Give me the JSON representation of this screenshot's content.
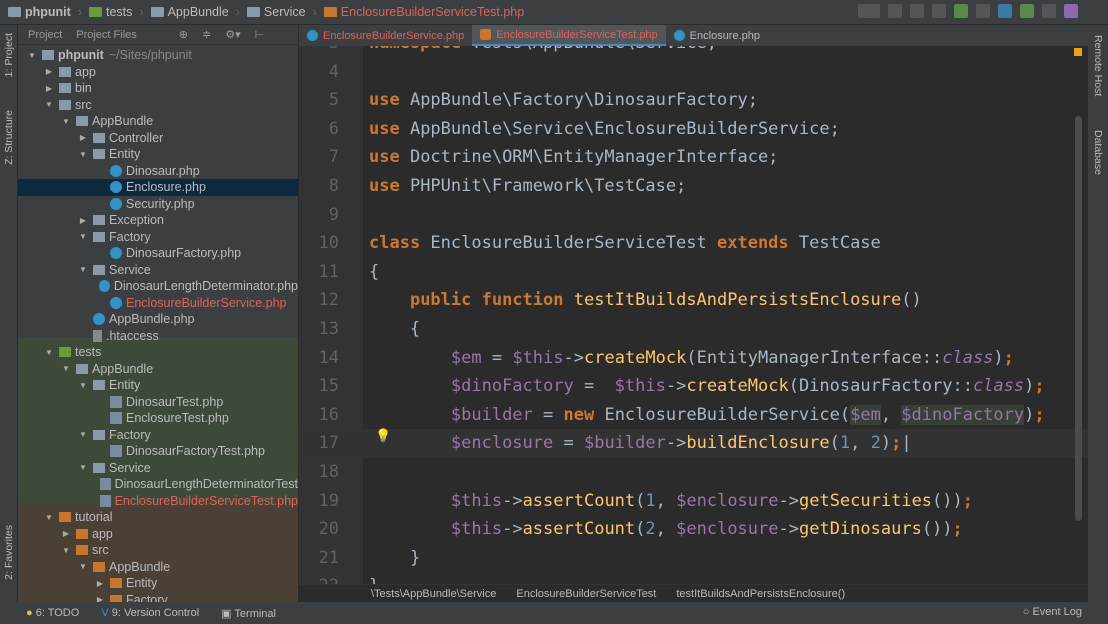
{
  "nav": {
    "crumbs": [
      "phpunit",
      "tests",
      "AppBundle",
      "Service"
    ],
    "file": "EnclosureBuilderServiceTest.php"
  },
  "left_tabs": {
    "project": "1: Project",
    "structure": "Z: Structure",
    "favorites": "2: Favorites"
  },
  "right_tabs": {
    "remote": "Remote Host",
    "database": "Database"
  },
  "sidebar": {
    "tabs": [
      "Project",
      "Project Files"
    ],
    "tree": [
      {
        "label": "phpunit",
        "suffix": "~/Sites/phpunit",
        "depth": 0,
        "type": "folder",
        "open": true,
        "bold": true
      },
      {
        "label": "app",
        "depth": 1,
        "type": "folder",
        "open": false
      },
      {
        "label": "bin",
        "depth": 1,
        "type": "folder",
        "open": false
      },
      {
        "label": "src",
        "depth": 1,
        "type": "folder",
        "open": true
      },
      {
        "label": "AppBundle",
        "depth": 2,
        "type": "folder",
        "open": true
      },
      {
        "label": "Controller",
        "depth": 3,
        "type": "folder",
        "open": false
      },
      {
        "label": "Entity",
        "depth": 3,
        "type": "folder",
        "open": true
      },
      {
        "label": "Dinosaur.php",
        "depth": 4,
        "type": "class"
      },
      {
        "label": "Enclosure.php",
        "depth": 4,
        "type": "class",
        "selected": true
      },
      {
        "label": "Security.php",
        "depth": 4,
        "type": "class"
      },
      {
        "label": "Exception",
        "depth": 3,
        "type": "folder",
        "open": false
      },
      {
        "label": "Factory",
        "depth": 3,
        "type": "folder",
        "open": true
      },
      {
        "label": "DinosaurFactory.php",
        "depth": 4,
        "type": "class"
      },
      {
        "label": "Service",
        "depth": 3,
        "type": "folder",
        "open": true
      },
      {
        "label": "DinosaurLengthDeterminator.php",
        "depth": 4,
        "type": "class"
      },
      {
        "label": "EnclosureBuilderService.php",
        "depth": 4,
        "type": "class",
        "modified": true
      },
      {
        "label": "AppBundle.php",
        "depth": 3,
        "type": "class"
      },
      {
        "label": ".htaccess",
        "depth": 3,
        "type": "file"
      },
      {
        "label": "tests",
        "depth": 1,
        "type": "folder",
        "open": true,
        "color": "green"
      },
      {
        "label": "AppBundle",
        "depth": 2,
        "type": "folder",
        "open": true
      },
      {
        "label": "Entity",
        "depth": 3,
        "type": "folder",
        "open": true
      },
      {
        "label": "DinosaurTest.php",
        "depth": 4,
        "type": "test"
      },
      {
        "label": "EnclosureTest.php",
        "depth": 4,
        "type": "test"
      },
      {
        "label": "Factory",
        "depth": 3,
        "type": "folder",
        "open": true
      },
      {
        "label": "DinosaurFactoryTest.php",
        "depth": 4,
        "type": "test"
      },
      {
        "label": "Service",
        "depth": 3,
        "type": "folder",
        "open": true
      },
      {
        "label": "DinosaurLengthDeterminatorTest",
        "depth": 4,
        "type": "test"
      },
      {
        "label": "EnclosureBuilderServiceTest.php",
        "depth": 4,
        "type": "test",
        "modified": true
      },
      {
        "label": "tutorial",
        "depth": 1,
        "type": "folder",
        "open": true,
        "color": "orange"
      },
      {
        "label": "app",
        "depth": 2,
        "type": "folder",
        "open": false,
        "color": "orange"
      },
      {
        "label": "src",
        "depth": 2,
        "type": "folder",
        "open": true,
        "color": "orange"
      },
      {
        "label": "AppBundle",
        "depth": 3,
        "type": "folder",
        "open": true,
        "color": "orange"
      },
      {
        "label": "Entity",
        "depth": 4,
        "type": "folder",
        "open": false,
        "color": "orange"
      },
      {
        "label": "Factory",
        "depth": 4,
        "type": "folder",
        "open": false,
        "color": "orange"
      }
    ]
  },
  "tabs": [
    {
      "label": "EnclosureBuilderService.php",
      "modified": true
    },
    {
      "label": "EnclosureBuilderServiceTest.php",
      "modified": true,
      "active": true
    },
    {
      "label": "Enclosure.php"
    }
  ],
  "code": [
    {
      "n": "3",
      "html": "<span class='k'>namespace</span> Tests\\AppBundle\\Service;"
    },
    {
      "n": "4",
      "html": ""
    },
    {
      "n": "5",
      "html": "<span class='k'>use</span> AppBundle\\Factory\\DinosaurFactory;"
    },
    {
      "n": "6",
      "html": "<span class='k'>use</span> AppBundle\\Service\\EnclosureBuilderService;"
    },
    {
      "n": "7",
      "html": "<span class='k'>use</span> Doctrine\\ORM\\EntityManagerInterface;"
    },
    {
      "n": "8",
      "html": "<span class='k'>use</span> PHPUnit\\Framework\\TestCase;"
    },
    {
      "n": "9",
      "html": ""
    },
    {
      "n": "10",
      "html": "<span class='k'>class</span> EnclosureBuilderServiceTest <span class='k'>extends</span> TestCase"
    },
    {
      "n": "11",
      "html": "{"
    },
    {
      "n": "12",
      "html": "    <span class='k'>public function</span> <span class='f'>testItBuildsAndPersistsEnclosure</span>()"
    },
    {
      "n": "13",
      "html": "    {"
    },
    {
      "n": "14",
      "html": "        <span class='v'>$em</span> = <span class='v'>$this</span>-><span class='f'>createMock</span>(EntityManagerInterface::<span class='i'>class</span>)<span class='k'>;</span>"
    },
    {
      "n": "15",
      "html": "        <span class='v'>$dinoFactory</span> =  <span class='v'>$this</span>-><span class='f'>createMock</span>(DinosaurFactory::<span class='i'>class</span>)<span class='k'>;</span>"
    },
    {
      "n": "16",
      "html": "        <span class='v'>$builder</span> = <span class='k'>new</span> EnclosureBuilderService(<span class='v hl'>$em</span>, <span class='v hl'>$dinoFactory</span>)<span class='k'>;</span>"
    },
    {
      "n": "17",
      "html": "        <span class='v'>$enclosure</span> = <span class='v'>$builder</span>-><span class='f'>buildEnclosure</span>(<span class='n'>1</span>, <span class='n'>2</span>)<span class='k'>;</span>|",
      "current": true
    },
    {
      "n": "18",
      "html": ""
    },
    {
      "n": "19",
      "html": "        <span class='v'>$this</span>-><span class='f'>assertCount</span>(<span class='n'>1</span>, <span class='v'>$enclosure</span>-><span class='f'>getSecurities</span>())<span class='k'>;</span>"
    },
    {
      "n": "20",
      "html": "        <span class='v'>$this</span>-><span class='f'>assertCount</span>(<span class='n'>2</span>, <span class='v'>$enclosure</span>-><span class='f'>getDinosaurs</span>())<span class='k'>;</span>"
    },
    {
      "n": "21",
      "html": "    }"
    },
    {
      "n": "22",
      "html": "}"
    }
  ],
  "breadcrumb": [
    "\\Tests\\AppBundle\\Service",
    "EnclosureBuilderServiceTest",
    "testItBuildsAndPersistsEnclosure()"
  ],
  "status": {
    "todo": "6: TODO",
    "vcs": "9: Version Control",
    "terminal": "Terminal",
    "event_log": "Event Log"
  }
}
